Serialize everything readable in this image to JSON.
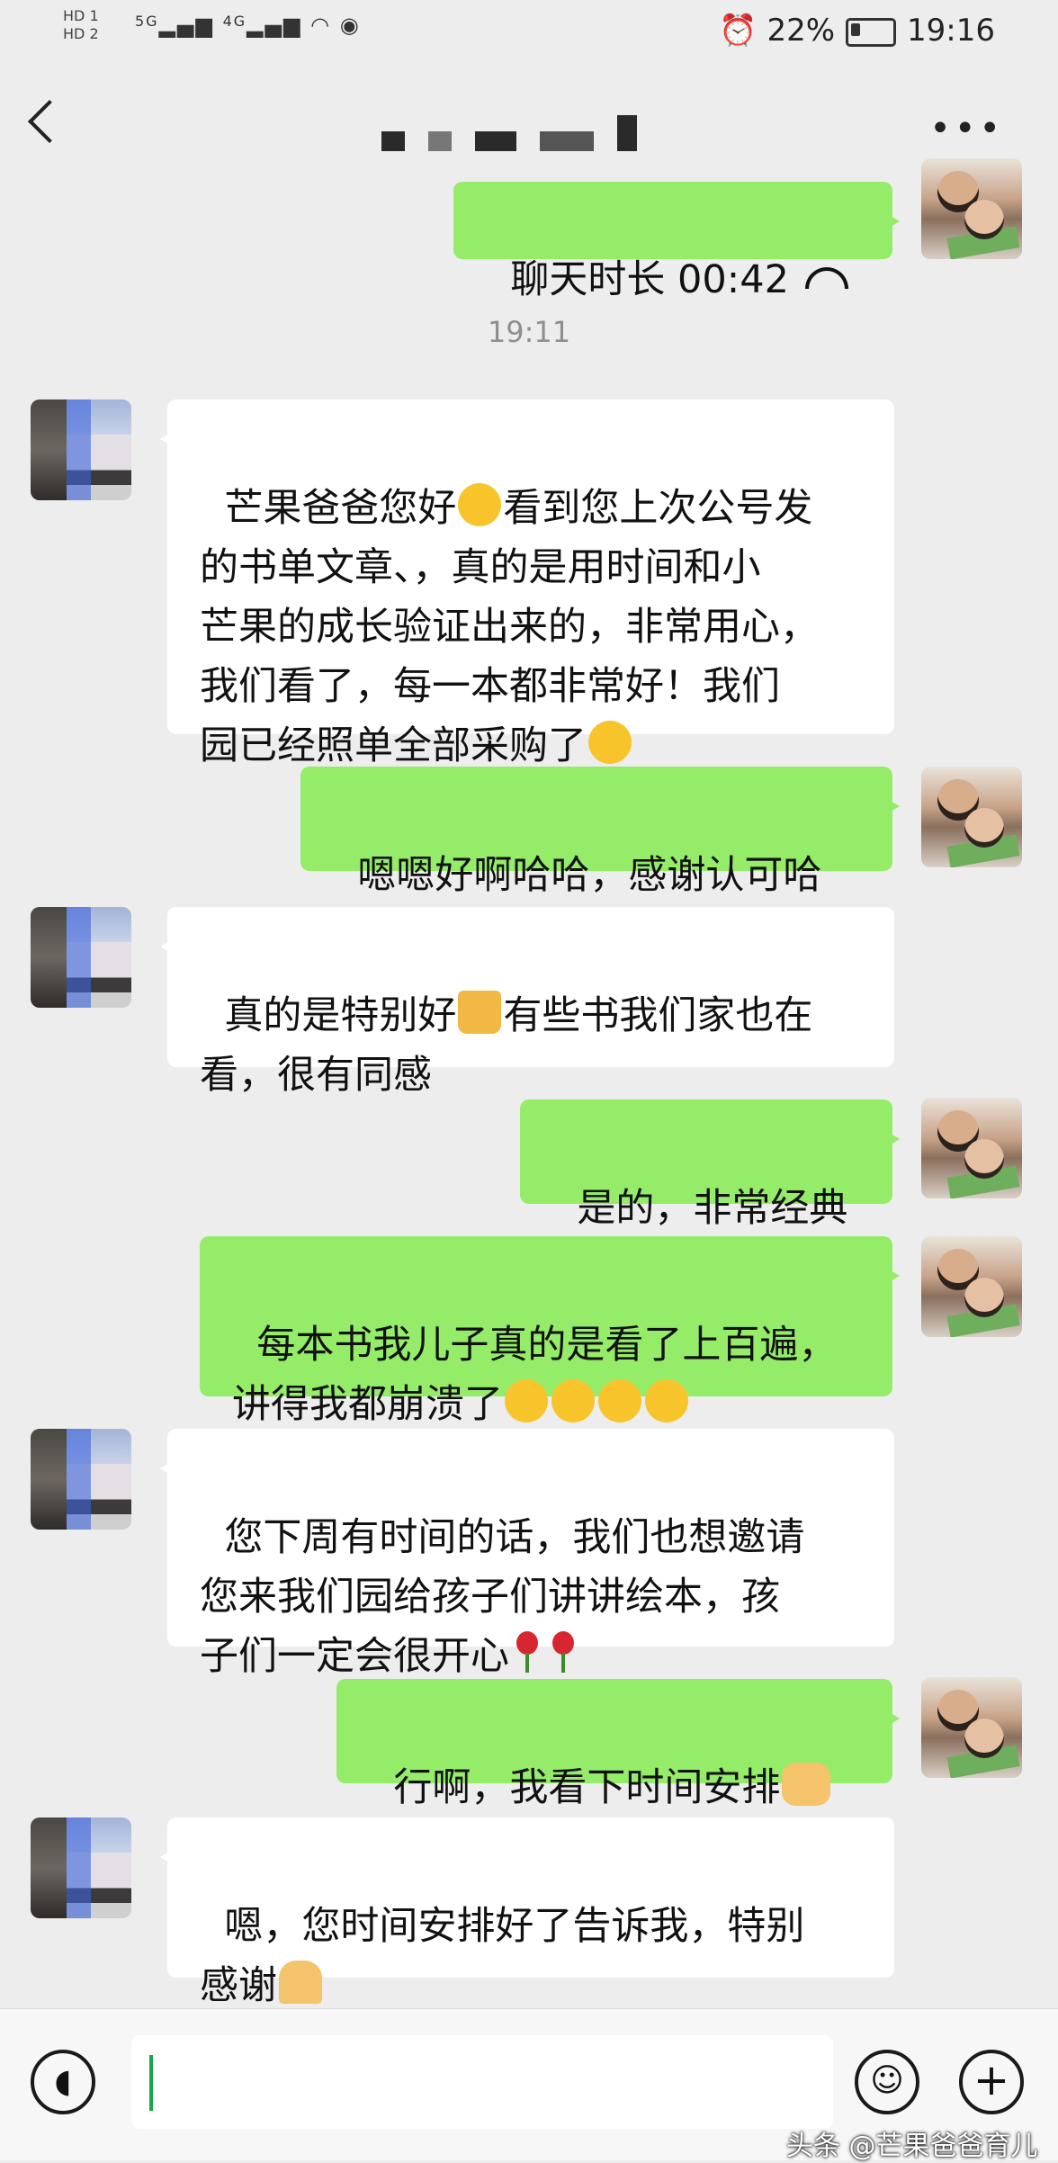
{
  "status_bar": {
    "left_labels": [
      "HD 1",
      "HD 2"
    ],
    "network": [
      "5G",
      "4G"
    ],
    "battery_percent": "22%",
    "time": "19:16"
  },
  "header": {
    "title_blurred": true
  },
  "messages": {
    "call_duration": "聊天时长 00:42",
    "timestamp": "19:11",
    "m1_a": "芒果爸爸您好",
    "m1_b": "看到您上次公号发\n的书单文章、，真的是用时间和小\n芒果的成长验证出来的，非常用心，\n我们看了，每一本都非常好！我们\n园已经照单全部采购了",
    "m2": "嗯嗯好啊哈哈，感谢认可哈",
    "m3_a": "真的是特别好",
    "m3_b": "有些书我们家也在\n看，很有同感",
    "m4": "是的，非常经典",
    "m5_a": "每本书我儿子真的是看了上百遍，\n讲得我都崩溃了",
    "m6": "您下周有时间的话，我们也想邀请\n您来我们园给孩子们讲讲绘本，孩\n子们一定会很开心",
    "m7": "行啊，我看下时间安排",
    "m8_a": "嗯，您时间安排好了告诉我，特别\n感谢"
  },
  "bottom_bar": {
    "input_value": "",
    "watermark": "头条 @芒果爸爸育儿"
  },
  "colors": {
    "outgoing_bubble": "#95ec69",
    "incoming_bubble": "#ffffff",
    "background": "#ededed"
  },
  "icons": [
    "back-chevron-icon",
    "more-dots-icon",
    "call-icon",
    "voice-icon",
    "emoji-icon",
    "plus-icon"
  ]
}
